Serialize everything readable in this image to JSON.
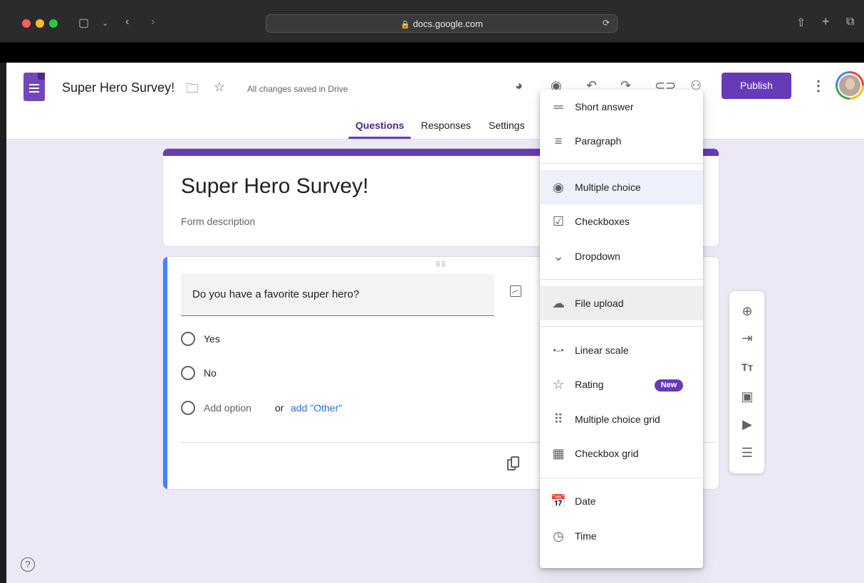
{
  "browser": {
    "url": "docs.google.com"
  },
  "header": {
    "doc_title": "Super Hero Survey!",
    "saved_status": "All changes saved in Drive",
    "publish_label": "Publish"
  },
  "tabs": [
    {
      "label": "Questions",
      "active": true
    },
    {
      "label": "Responses",
      "active": false
    },
    {
      "label": "Settings",
      "active": false
    }
  ],
  "form": {
    "title": "Super Hero Survey!",
    "description": "Form description"
  },
  "question": {
    "text": "Do you have a favorite super hero?",
    "options": [
      "Yes",
      "No"
    ],
    "add_option": "Add option",
    "or_text": "or",
    "add_other": "add \"Other\""
  },
  "menu": {
    "items": [
      {
        "label": "Short answer",
        "icon": "short-answer-icon"
      },
      {
        "label": "Paragraph",
        "icon": "paragraph-icon"
      },
      {
        "label": "Multiple choice",
        "icon": "radio-icon",
        "selected": true
      },
      {
        "label": "Checkboxes",
        "icon": "checkbox-icon"
      },
      {
        "label": "Dropdown",
        "icon": "dropdown-icon"
      },
      {
        "label": "File upload",
        "icon": "cloud-upload-icon",
        "hovered": true
      },
      {
        "label": "Linear scale",
        "icon": "linear-scale-icon"
      },
      {
        "label": "Rating",
        "icon": "star-icon",
        "badge": "New"
      },
      {
        "label": "Multiple choice grid",
        "icon": "grid-dots-icon"
      },
      {
        "label": "Checkbox grid",
        "icon": "grid-squares-icon"
      },
      {
        "label": "Date",
        "icon": "calendar-icon"
      },
      {
        "label": "Time",
        "icon": "clock-icon"
      }
    ]
  },
  "colors": {
    "brand": "#673ab7",
    "link": "#1a73e8",
    "question_accent": "#4285f4",
    "background": "#ece8f5"
  }
}
